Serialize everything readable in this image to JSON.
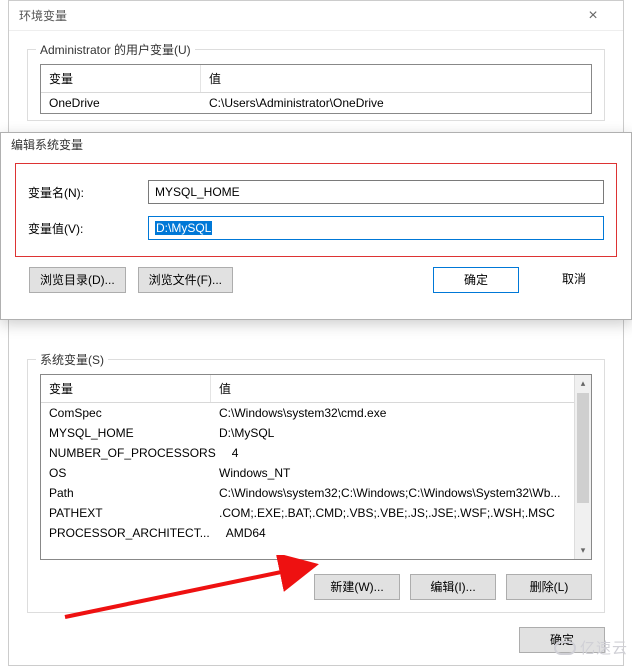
{
  "back": {
    "title": "环境变量",
    "close_glyph": "×",
    "user_group_caption": "Administrator 的用户变量(U)",
    "col_var": "变量",
    "col_val": "值",
    "user_rows": [
      {
        "name": "OneDrive",
        "value": "C:\\Users\\Administrator\\OneDrive"
      }
    ],
    "sys_group_caption": "系统变量(S)",
    "sys_rows": [
      {
        "name": "ComSpec",
        "value": "C:\\Windows\\system32\\cmd.exe"
      },
      {
        "name": "MYSQL_HOME",
        "value": "D:\\MySQL"
      },
      {
        "name": "NUMBER_OF_PROCESSORS",
        "value": "4"
      },
      {
        "name": "OS",
        "value": "Windows_NT"
      },
      {
        "name": "Path",
        "value": "C:\\Windows\\system32;C:\\Windows;C:\\Windows\\System32\\Wb..."
      },
      {
        "name": "PATHEXT",
        "value": ".COM;.EXE;.BAT;.CMD;.VBS;.VBE;.JS;.JSE;.WSF;.WSH;.MSC"
      },
      {
        "name": "PROCESSOR_ARCHITECT...",
        "value": "AMD64"
      }
    ],
    "sys_buttons": {
      "new": "新建(W)...",
      "edit": "编辑(I)...",
      "del": "删除(L)"
    },
    "ok_label": "确定"
  },
  "edit": {
    "title": "编辑系统变量",
    "name_label": "变量名(N):",
    "name_value": "MYSQL_HOME",
    "value_label": "变量值(V):",
    "value_value": "D:\\MySQL",
    "browse_dir": "浏览目录(D)...",
    "browse_file": "浏览文件(F)...",
    "ok": "确定",
    "cancel": "取消"
  },
  "watermark_text": "亿速云"
}
